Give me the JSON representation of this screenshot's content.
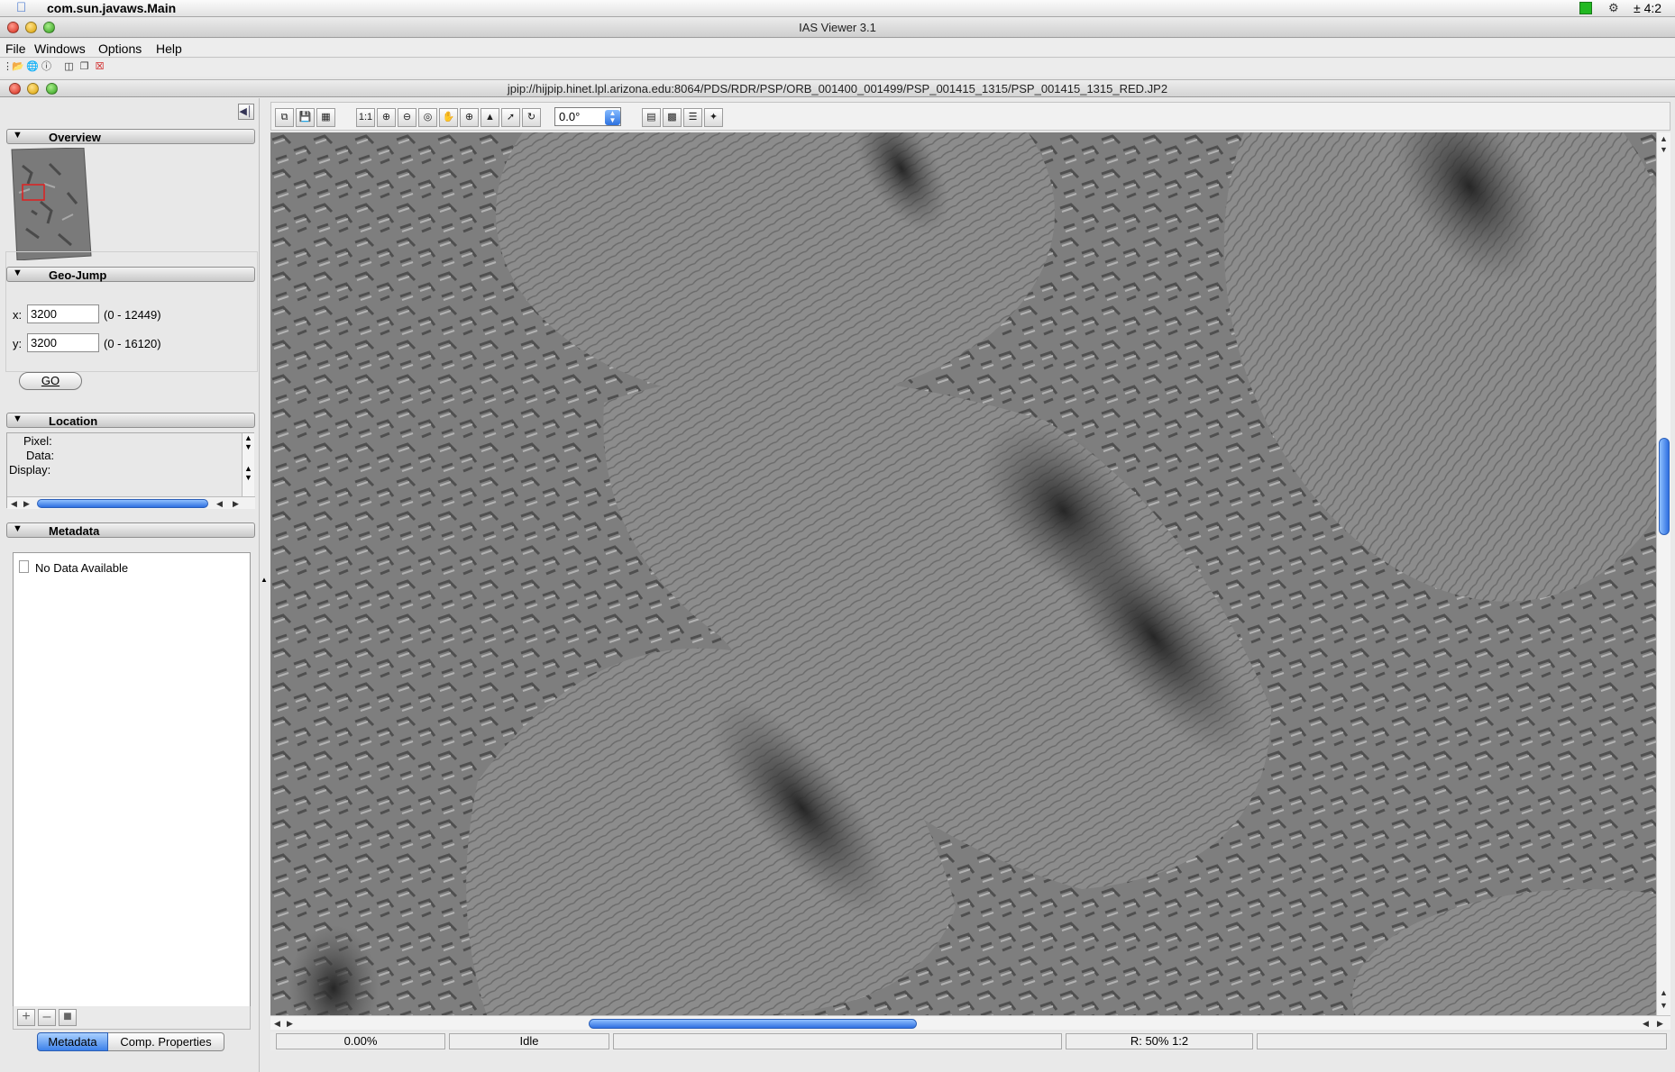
{
  "system": {
    "app_name": "com.sun.javaws.Main",
    "clock": "± 4:2"
  },
  "window": {
    "title": "IAS Viewer 3.1"
  },
  "menu": {
    "items": [
      "File",
      "Windows",
      "Options",
      "Help"
    ]
  },
  "frame": {
    "title": "jpip://hijpip.hinet.lpl.arizona.edu:8064/PDS/RDR/PSP/ORB_001400_001499/PSP_001415_1315/PSP_001415_1315_RED.JP2"
  },
  "sidebar": {
    "sections": {
      "overview": "Overview",
      "geo_jump": "Geo-Jump",
      "location": "Location",
      "metadata": "Metadata"
    },
    "geo_jump": {
      "x_label": "x:",
      "x_value": "3200",
      "x_range": "(0 - 12449)",
      "y_label": "y:",
      "y_value": "3200",
      "y_range": "(0 - 16120)",
      "go_label": "GO"
    },
    "location": {
      "pixel_label": "Pixel:",
      "data_label": "Data:",
      "display_label": "Display:"
    },
    "metadata": {
      "empty_text": "No Data Available"
    },
    "tabs": [
      "Metadata",
      "Comp. Properties"
    ]
  },
  "toolbar": {
    "one_to_one": "1:1",
    "rotation_value": "0.0°"
  },
  "status": {
    "progress": "0.00%",
    "state": "Idle",
    "resolution": "R: 50% 1:2"
  },
  "colors": {
    "accent": "#3d82ea",
    "image_gray": "#7d7d7d"
  }
}
